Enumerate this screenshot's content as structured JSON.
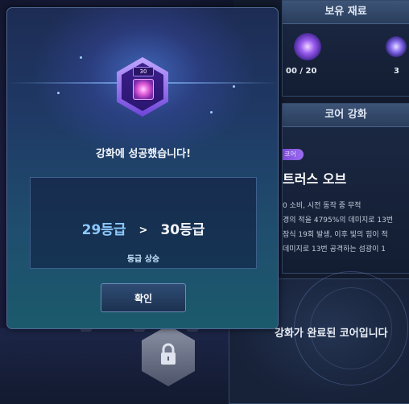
{
  "dialog": {
    "core_level_badge": "30",
    "success_message": "강화에 성공했습니다!",
    "grade_from": "29등급",
    "grade_arrow": ">",
    "grade_to": "30등급",
    "grade_status": "등급 상승",
    "confirm_label": "확인"
  },
  "materials_panel": {
    "title": "보유 재료",
    "left_count": "00 / 20",
    "right_count": "3"
  },
  "core_panel": {
    "title": "코어 강화",
    "tag": "코어",
    "core_name": "트러스 오브",
    "description_lines": [
      "0 소비, 시전 동작 중 무적",
      "경의 적을 4795%의 데미지로 13번",
      "잠식 19회 발생, 이후 빛의 힘이 적",
      "데미지로 13번 공격하는 섬광이 1"
    ]
  },
  "status_panel": {
    "message": "강화가 완료된 코어입니다"
  },
  "colors": {
    "grade_from": "#8ec9ff",
    "accent_purple": "#7d4bd8",
    "dialog_bottom": "#1b5a6c"
  },
  "icons": {
    "lock": "lock-icon",
    "core": "core-icon",
    "material_left": "material-orb-icon",
    "material_right": "material-orb-icon"
  }
}
